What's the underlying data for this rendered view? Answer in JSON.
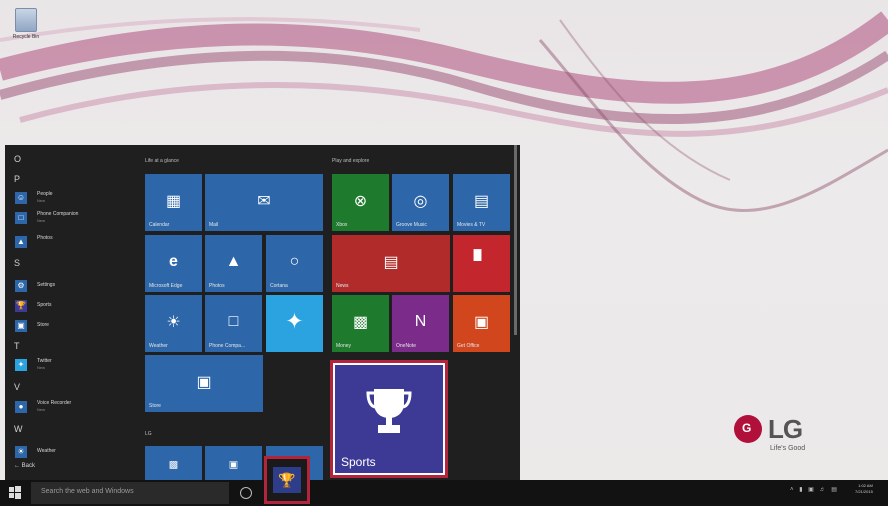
{
  "desktop": {
    "recycle_bin_label": "Recycle Bin"
  },
  "start_menu": {
    "apps": [
      {
        "letter": "O"
      },
      {
        "letter": "P"
      },
      {
        "name": "People",
        "sub": "New",
        "icon": "people-icon"
      },
      {
        "name": "Phone Companion",
        "sub": "New",
        "icon": "phone-icon"
      },
      {
        "name": "Photos",
        "sub": "",
        "icon": "photos-icon"
      },
      {
        "letter": "S"
      },
      {
        "name": "Settings",
        "sub": "",
        "icon": "gear-icon"
      },
      {
        "name": "Sports",
        "sub": "",
        "icon": "trophy-icon"
      },
      {
        "name": "Store",
        "sub": "",
        "icon": "store-icon"
      },
      {
        "letter": "T"
      },
      {
        "name": "Twitter",
        "sub": "New",
        "icon": "twitter-icon"
      },
      {
        "letter": "V"
      },
      {
        "name": "Voice Recorder",
        "sub": "New",
        "icon": "microphone-icon"
      },
      {
        "letter": "W"
      },
      {
        "name": "Weather",
        "sub": "",
        "icon": "weather-icon"
      }
    ],
    "back_label": "Back",
    "groups": {
      "life": "Life at a glance",
      "play": "Play and explore",
      "lg": "LG"
    },
    "tiles": {
      "calendar": "Calendar",
      "mail": "Mail",
      "edge": "Microsoft Edge",
      "photos": "Photos",
      "cortana": "Cortana",
      "weather": "Weather",
      "phone": "Phone Compa...",
      "twitter": "",
      "store": "Store",
      "xbox": "Xbox",
      "groove": "Groove Music",
      "movies": "Movies & TV",
      "news": "News",
      "flipboard": "",
      "money": "Money",
      "onenote": "OneNote",
      "office": "Get Office"
    }
  },
  "highlight": {
    "sports_tile_label": "Sports"
  },
  "taskbar": {
    "search_placeholder": "Search the web and Windows",
    "clock_time": "1:02 AM",
    "clock_date": "7/21/2015"
  },
  "brand": {
    "logo_text": "LG",
    "slogan": "Life's Good",
    "accent_color": "#b3253c",
    "tile_blue": "#2d67a9",
    "sports_purple": "#3d3a96"
  }
}
